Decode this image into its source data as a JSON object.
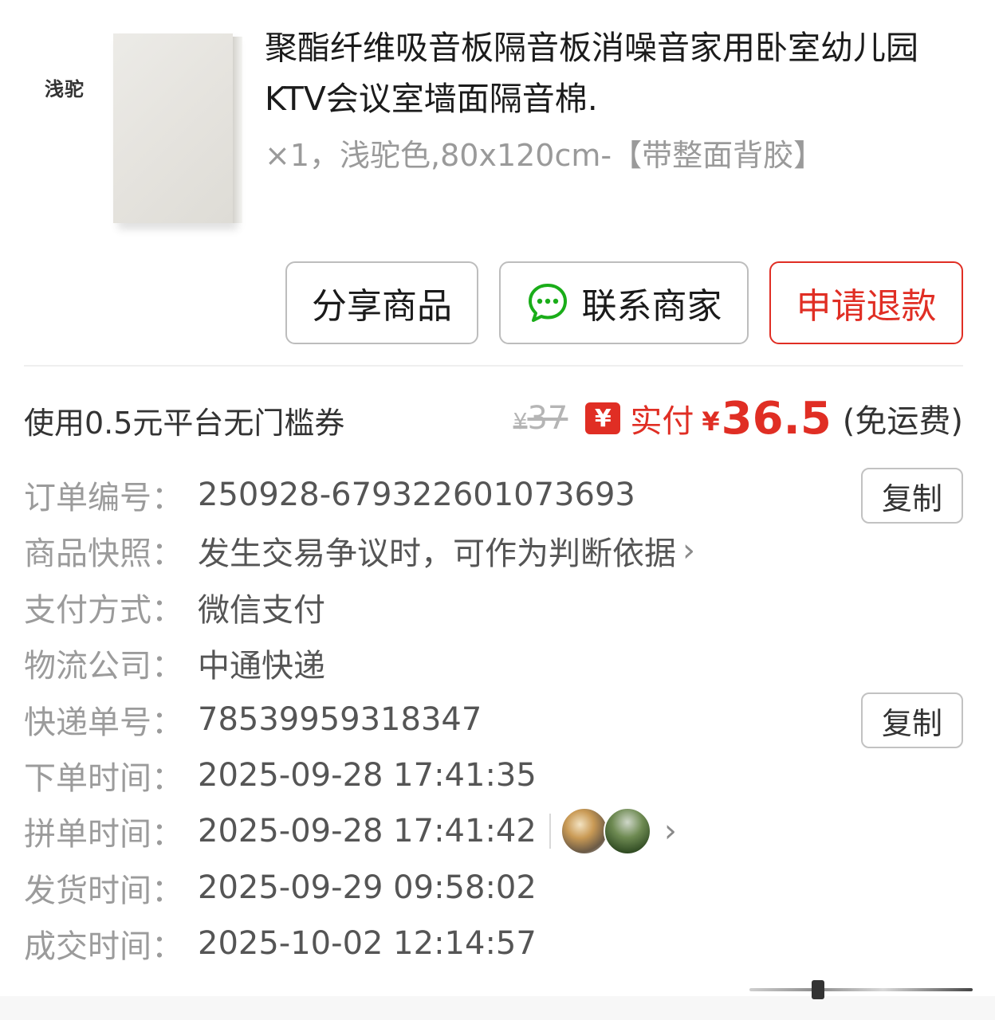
{
  "product": {
    "thumb_label": "浅驼",
    "title": "聚酯纤维吸音板隔音板消噪音家用卧室幼儿园KTV会议室墙面隔音棉.",
    "spec": "×1，浅驼色,80x120cm-【带整面背胶】"
  },
  "actions": {
    "share": "分享商品",
    "contact": "联系商家",
    "refund": "申请退款",
    "contact_icon": "chat-bubble-icon",
    "accent_color": "#e02e24",
    "chat_color": "#1aad19"
  },
  "price": {
    "coupon": "使用0.5元平台无门槛券",
    "original_symbol": "¥",
    "original": "37",
    "badge": "¥",
    "paid_label": "实付",
    "paid_symbol": "¥",
    "paid_value": "36.5",
    "shipping": "(免运费)"
  },
  "info": {
    "order_no_label": "订单编号：",
    "order_no": "250928-679322601073693",
    "snapshot_label": "商品快照：",
    "snapshot": "发生交易争议时，可作为判断依据",
    "payment_label": "支付方式：",
    "payment": "微信支付",
    "courier_label": "物流公司：",
    "courier": "中通快递",
    "tracking_label": "快递单号：",
    "tracking": "78539959318347",
    "order_time_label": "下单时间：",
    "order_time": "2025-09-28 17:41:35",
    "group_time_label": "拼单时间：",
    "group_time": "2025-09-28 17:41:42",
    "ship_time_label": "发货时间：",
    "ship_time": "2025-09-29 09:58:02",
    "deal_time_label": "成交时间：",
    "deal_time": "2025-10-02 12:14:57",
    "copy_label": "复制",
    "chevron_icon": "chevron-right-icon"
  }
}
